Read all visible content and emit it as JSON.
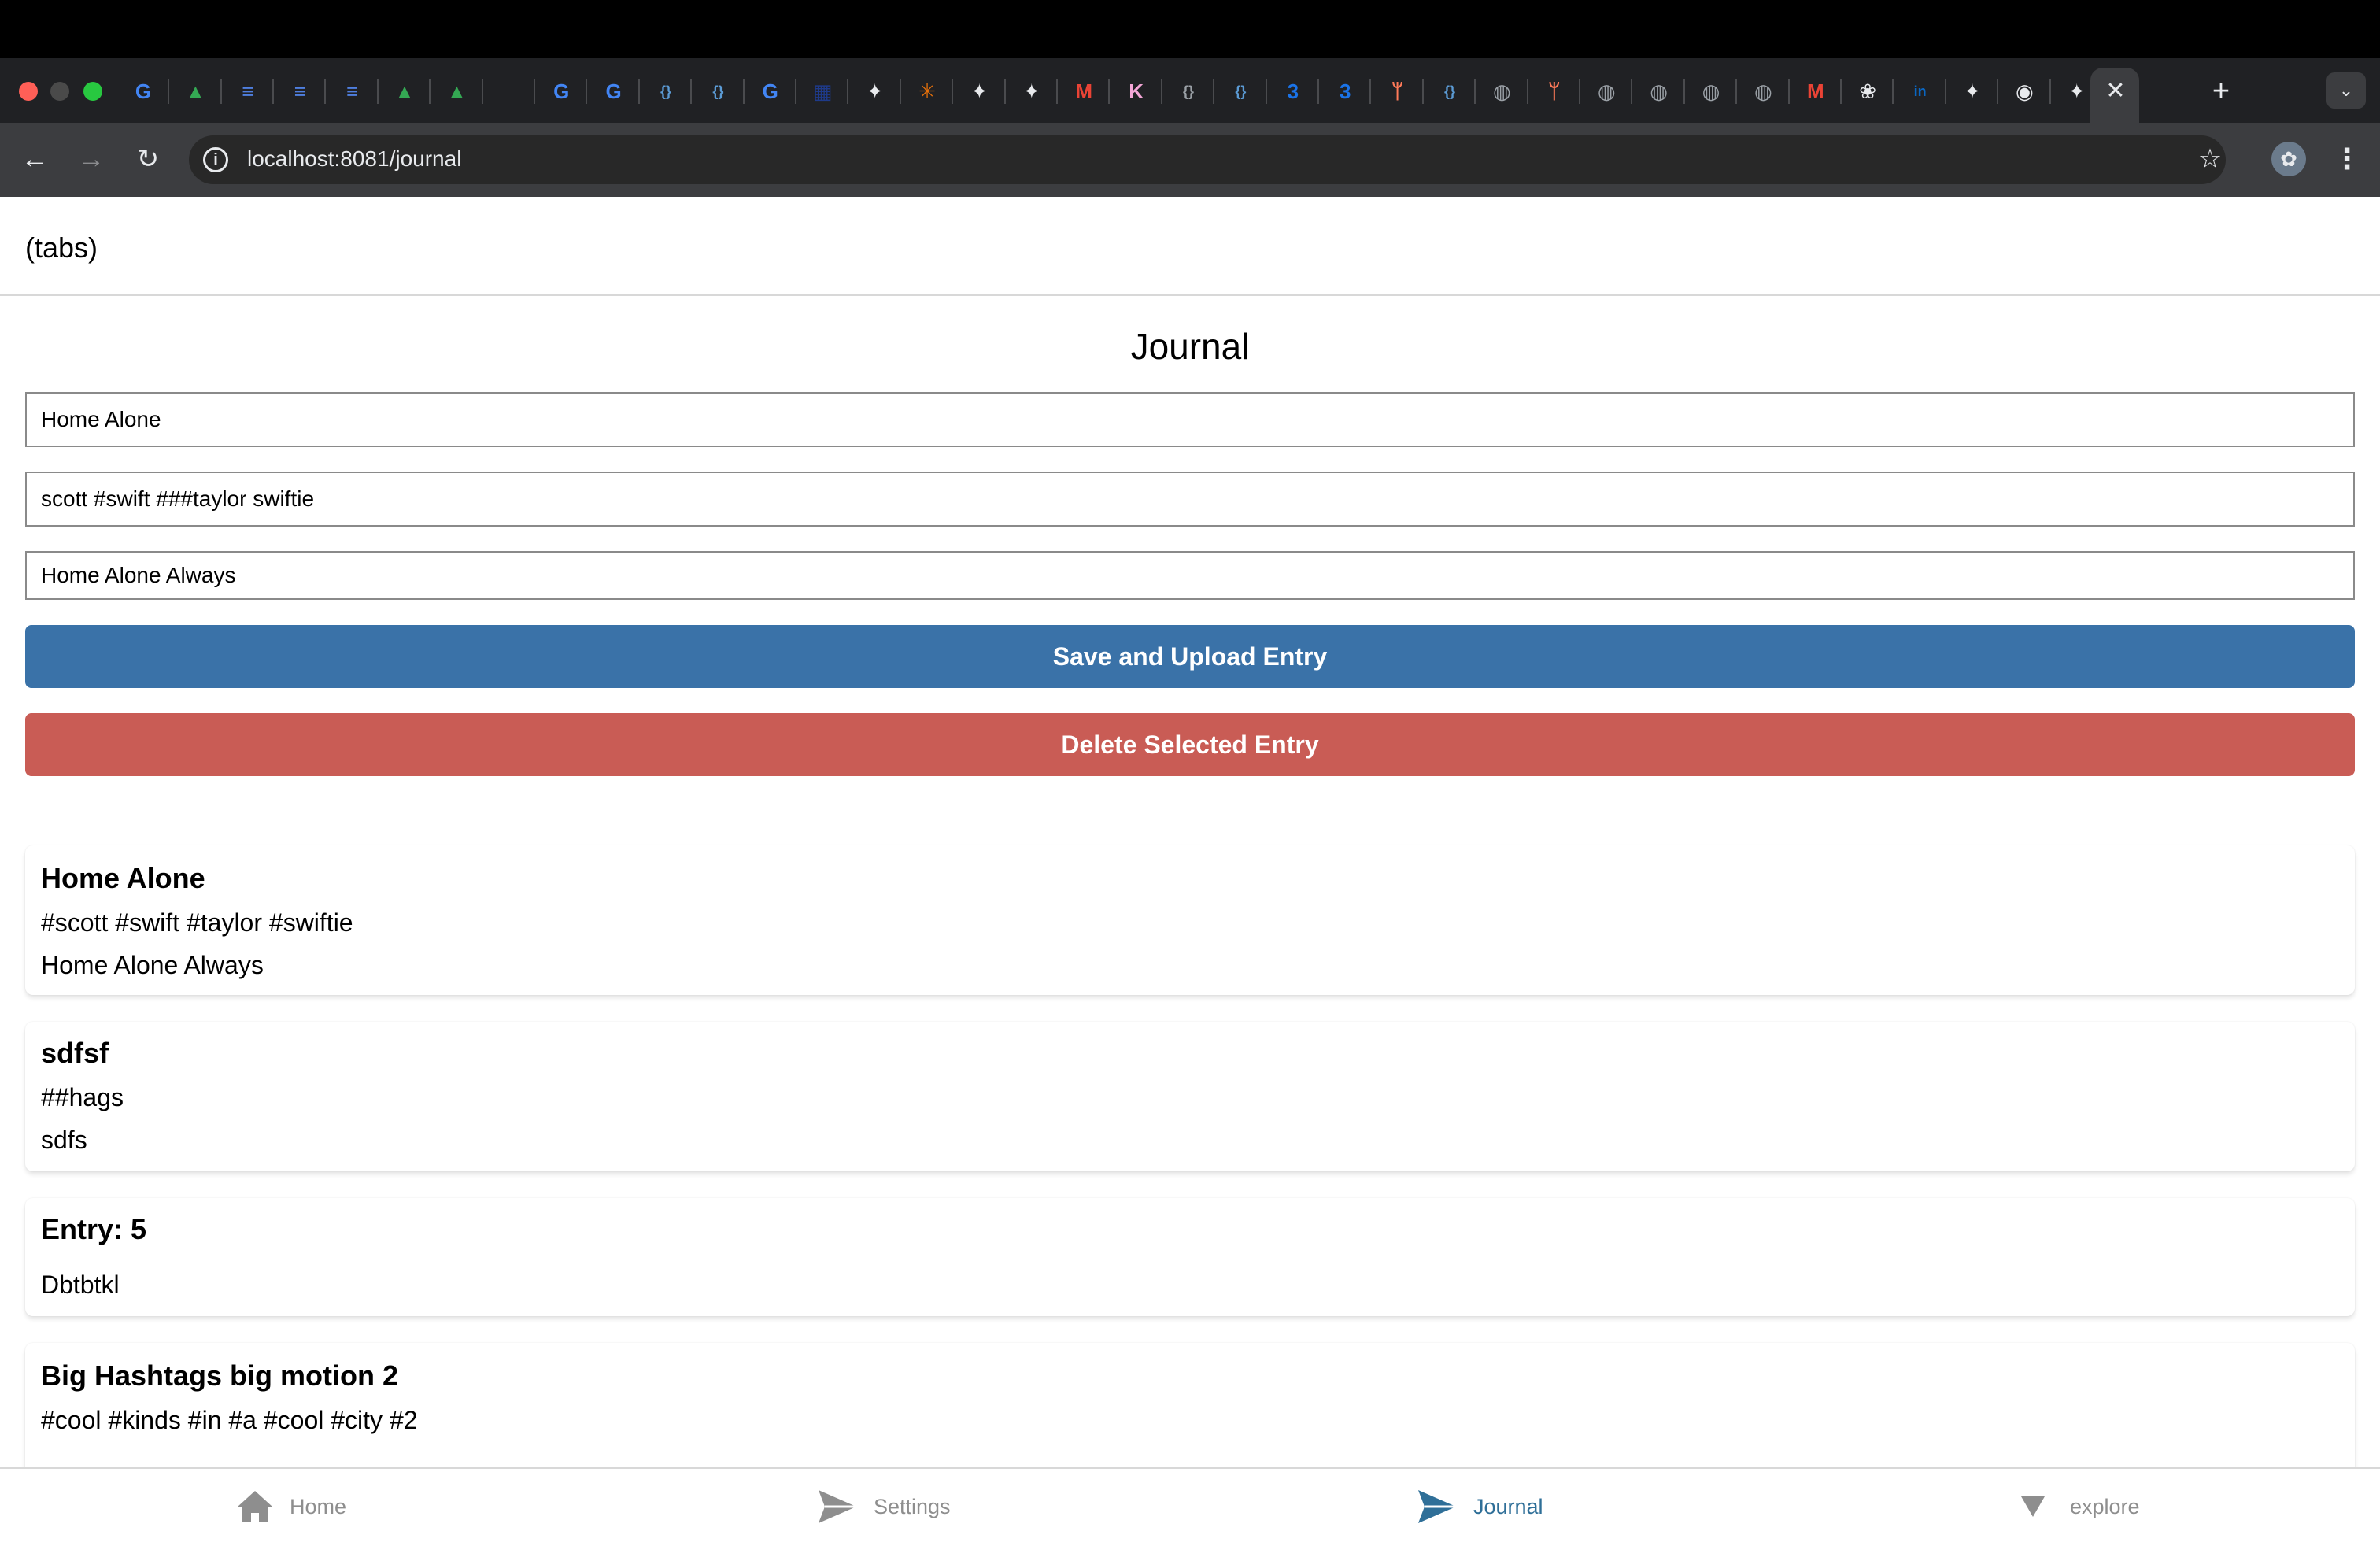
{
  "browser": {
    "url": "localhost:8081/journal",
    "active_tab_close": "✕",
    "new_tab": "+",
    "tab_search": "⌄",
    "tab_favicons": [
      "G",
      "▲",
      "≡",
      "≡",
      "≡",
      "▲",
      "▲",
      "",
      "G",
      "G",
      "{}",
      "{}",
      "G",
      "▦",
      "✦",
      "✳",
      "✦",
      "✦",
      "M",
      "K",
      "{}",
      "{}",
      "3",
      "3",
      "ᛘ",
      "{}",
      "◍",
      "ᛘ",
      "◍",
      "◍",
      "◍",
      "◍",
      "M",
      "❀",
      "in",
      "✦",
      "◉",
      "✦",
      "🔥"
    ]
  },
  "app": {
    "header_title": "(tabs)",
    "page_title": "Journal",
    "form": {
      "title_value": "Home Alone",
      "tags_value": "scott #swift ###taylor swiftie",
      "body_value": "Home Alone Always",
      "save_label": "Save and Upload Entry",
      "delete_label": "Delete Selected Entry"
    },
    "entries": [
      {
        "title": "Home Alone",
        "tags": "#scott #swift #taylor #swiftie",
        "body": "Home Alone Always"
      },
      {
        "title": "sdfsf",
        "tags": "##hags",
        "body": "sdfs"
      },
      {
        "title": "Entry: 5",
        "tags": "",
        "body": "Dbtbtkl"
      },
      {
        "title": "Big Hashtags big motion 2",
        "tags": "#cool #kinds #in #a #cool #city #2",
        "body": ""
      }
    ],
    "bottom_tabs": [
      {
        "label": "Home",
        "icon": "home-icon"
      },
      {
        "label": "Settings",
        "icon": "send-icon"
      },
      {
        "label": "Journal",
        "icon": "send-icon",
        "active": true
      },
      {
        "label": "explore",
        "icon": "triangle-down-icon"
      }
    ]
  },
  "colors": {
    "save_button": "#3a72a8",
    "delete_button": "#c95c55",
    "active_tab": "#2f6f98",
    "inactive_tab": "#8e8e8e"
  }
}
